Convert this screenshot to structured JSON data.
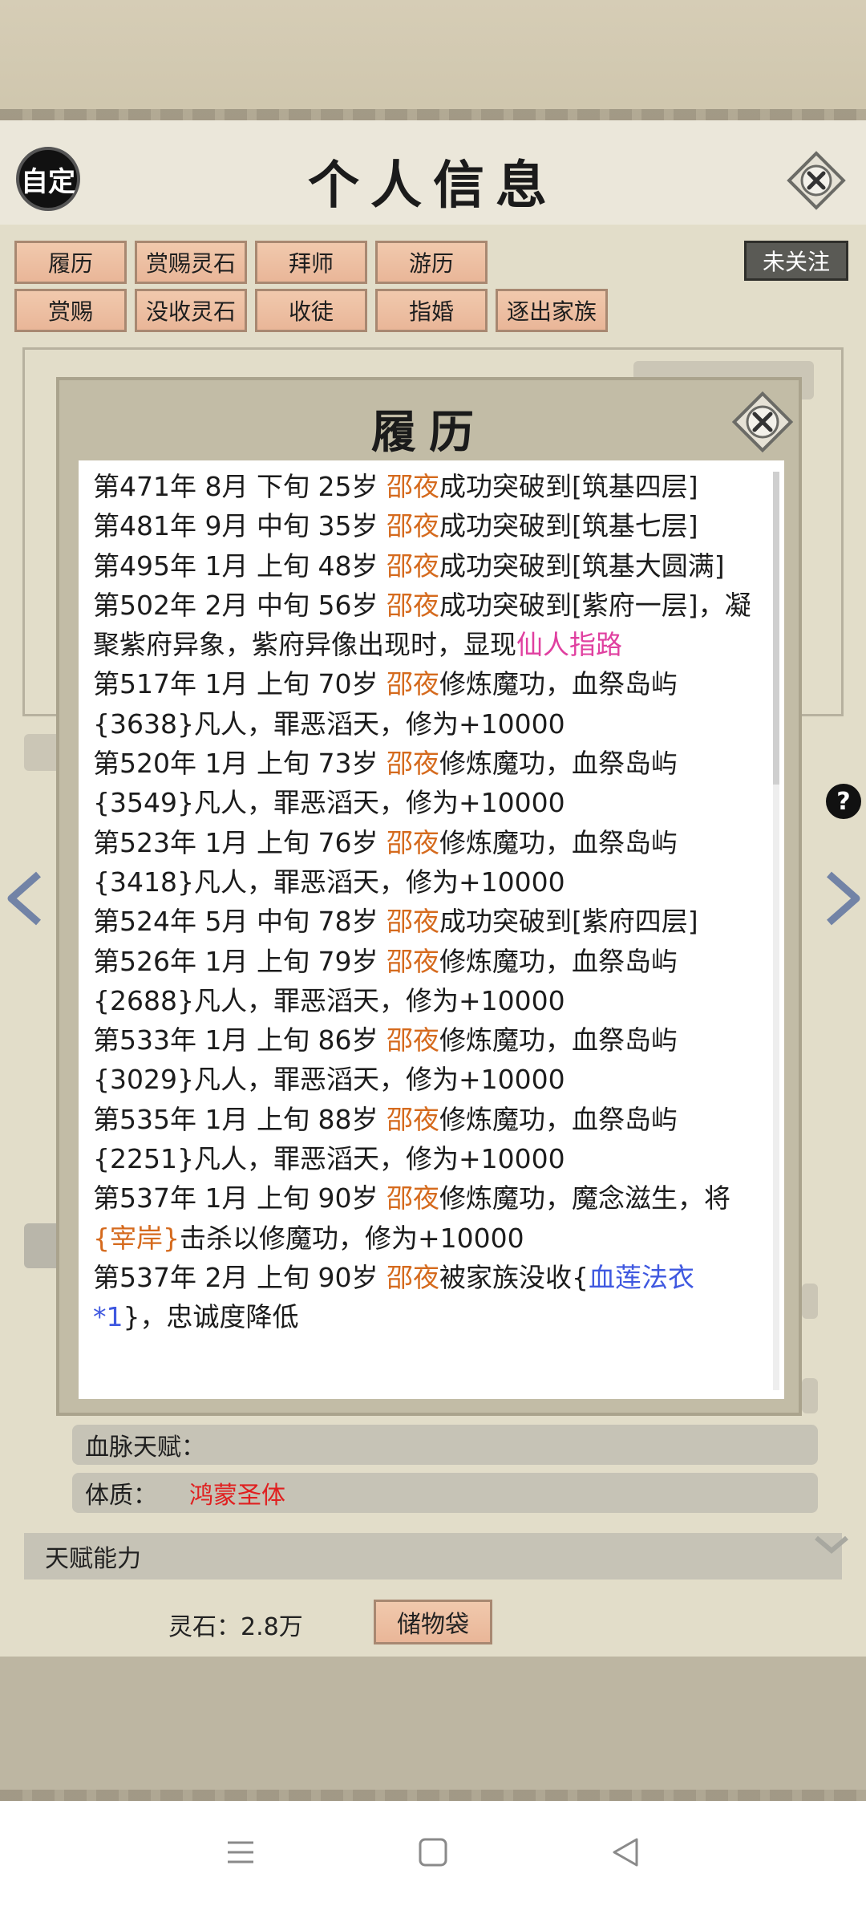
{
  "header": {
    "custom_label": "自定",
    "title": "个人信息",
    "follow_label": "未关注"
  },
  "actions": {
    "row1": [
      "履历",
      "赏赐灵石",
      "拜师",
      "游历"
    ],
    "row2": [
      "赏赐",
      "没收灵石",
      "收徒",
      "指婚",
      "逐出家族"
    ]
  },
  "modal": {
    "title": "履历",
    "entries": [
      {
        "pre": "第471年 8月 下旬  25岁  ",
        "name": "邵夜",
        "post": "成功突破到[筑基四层]"
      },
      {
        "pre": "第481年 9月 中旬  35岁  ",
        "name": "邵夜",
        "post": "成功突破到[筑基七层]"
      },
      {
        "pre": "第495年 1月 上旬  48岁 ",
        "name": "邵夜",
        "post": "成功突破到[筑基大圆满]"
      },
      {
        "pre": "第502年 2月 中旬  56岁 ",
        "name": "邵夜",
        "post": "成功突破到[紫府一层]，凝聚紫府异象，紫府异像出现时，显现",
        "extra": "仙人指路",
        "extra_color": "pink"
      },
      {
        "pre": "第517年  1月  上旬   70岁   ",
        "name": "邵夜",
        "post": "修炼魔功，血祭岛屿{3638}凡人，罪恶滔天，修为+10000"
      },
      {
        "pre": "第520年  1月  上旬   73岁   ",
        "name": "邵夜",
        "post": "修炼魔功，血祭岛屿{3549}凡人，罪恶滔天，修为+10000"
      },
      {
        "pre": "第523年  1月  上旬   76岁   ",
        "name": "邵夜",
        "post": "修炼魔功，血祭岛屿{3418}凡人，罪恶滔天，修为+10000"
      },
      {
        "pre": "第524年 5月 中旬  78岁  ",
        "name": "邵夜",
        "post": "成功突破到[紫府四层]"
      },
      {
        "pre": "第526年  1月  上旬   79岁   ",
        "name": "邵夜",
        "post": "修炼魔功，血祭岛屿{2688}凡人，罪恶滔天，修为+10000"
      },
      {
        "pre": "第533年  1月  上旬   86岁   ",
        "name": "邵夜",
        "post": "修炼魔功，血祭岛屿{3029}凡人，罪恶滔天，修为+10000"
      },
      {
        "pre": "第535年  1月  上旬   88岁   ",
        "name": "邵夜",
        "post": "修炼魔功，血祭岛屿{2251}凡人，罪恶滔天，修为+10000"
      },
      {
        "pre": "第537年 1月 上旬 90岁 ",
        "name": "邵夜",
        "post": "修炼魔功，魔念滋生，将",
        "extra": "{宰岸}",
        "extra_color": "orange",
        "post2": "击杀以修魔功，修为+10000"
      },
      {
        "pre": "第537年  2月  上旬   90岁   ",
        "name": "邵夜",
        "post": "被家族没收{",
        "extra": "血莲法衣*1",
        "extra_color": "blue",
        "post2": "}，忠诚度降低"
      }
    ]
  },
  "details": {
    "bloodline_label": "血脉天赋：",
    "physique_label": "体质：",
    "physique_value": "鸿蒙圣体",
    "talent_label": "天赋能力",
    "stone_label": "灵石：2.8万",
    "bag_label": "储物袋"
  },
  "colors": {
    "name": "#d56a1d",
    "pink": "#e040a0",
    "blue": "#3f58e0",
    "physique": "#e02020"
  }
}
